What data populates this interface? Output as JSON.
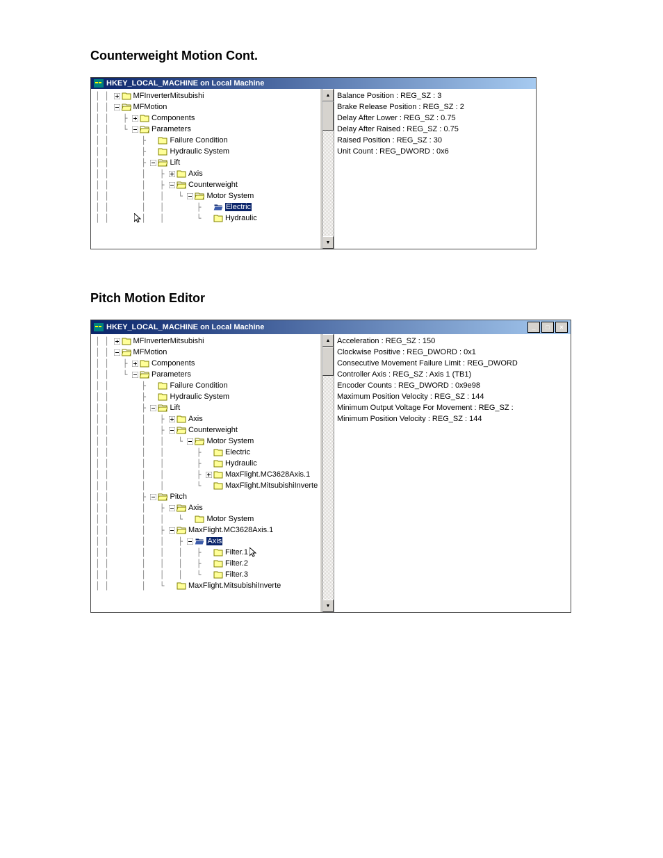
{
  "section1": {
    "heading": "Counterweight Motion Cont.",
    "window_title": "HKEY_LOCAL_MACHINE on Local Machine",
    "tree": [
      {
        "indent": "│ │ ",
        "box": "plus",
        "icon": "closed",
        "label": "MFInverterMitsubishi"
      },
      {
        "indent": "│ │ ",
        "box": "minus",
        "icon": "open",
        "label": "MFMotion"
      },
      {
        "indent": "│ │   ├ ",
        "box": "plus",
        "icon": "closed",
        "label": "Components"
      },
      {
        "indent": "│ │   └ ",
        "box": "minus",
        "icon": "open",
        "label": "Parameters"
      },
      {
        "indent": "│ │       ├ ",
        "box": "",
        "icon": "closed",
        "label": "Failure Condition"
      },
      {
        "indent": "│ │       ├ ",
        "box": "",
        "icon": "closed",
        "label": "Hydraulic System"
      },
      {
        "indent": "│ │       ├ ",
        "box": "minus",
        "icon": "open",
        "label": "Lift"
      },
      {
        "indent": "│ │       │   ├ ",
        "box": "plus",
        "icon": "closed",
        "label": "Axis"
      },
      {
        "indent": "│ │       │   ├ ",
        "box": "minus",
        "icon": "open",
        "label": "Counterweight"
      },
      {
        "indent": "│ │       │   │   └ ",
        "box": "minus",
        "icon": "open",
        "label": "Motor System"
      },
      {
        "indent": "│ │       │   │       ├ ",
        "box": "",
        "icon": "sel",
        "label": "Electric",
        "selected": true
      },
      {
        "indent": "│ │       │   │       └ ",
        "box": "",
        "icon": "closed",
        "label": "Hydraulic"
      }
    ],
    "cursor_on_row": 11,
    "values": [
      "Balance Position : REG_SZ : 3",
      "Brake Release Position : REG_SZ : 2",
      "Delay After Lower : REG_SZ : 0.75",
      "Delay After Raised : REG_SZ : 0.75",
      "Raised Position : REG_SZ : 30",
      "Unit Count : REG_DWORD : 0x6"
    ]
  },
  "section2": {
    "heading": "Pitch Motion Editor",
    "window_title": "HKEY_LOCAL_MACHINE on Local Machine",
    "tree": [
      {
        "indent": "│ │ ",
        "box": "plus",
        "icon": "closed",
        "label": "MFInverterMitsubishi"
      },
      {
        "indent": "│ │ ",
        "box": "minus",
        "icon": "open",
        "label": "MFMotion"
      },
      {
        "indent": "│ │   ├ ",
        "box": "plus",
        "icon": "closed",
        "label": "Components"
      },
      {
        "indent": "│ │   └ ",
        "box": "minus",
        "icon": "open",
        "label": "Parameters"
      },
      {
        "indent": "│ │       ├ ",
        "box": "",
        "icon": "closed",
        "label": "Failure Condition"
      },
      {
        "indent": "│ │       ├ ",
        "box": "",
        "icon": "closed",
        "label": "Hydraulic System"
      },
      {
        "indent": "│ │       ├ ",
        "box": "minus",
        "icon": "open",
        "label": "Lift"
      },
      {
        "indent": "│ │       │   ├ ",
        "box": "plus",
        "icon": "closed",
        "label": "Axis"
      },
      {
        "indent": "│ │       │   ├ ",
        "box": "minus",
        "icon": "open",
        "label": "Counterweight"
      },
      {
        "indent": "│ │       │   │   └ ",
        "box": "minus",
        "icon": "open",
        "label": "Motor System"
      },
      {
        "indent": "│ │       │   │       ├ ",
        "box": "",
        "icon": "closed",
        "label": "Electric"
      },
      {
        "indent": "│ │       │   │       ├ ",
        "box": "",
        "icon": "closed",
        "label": "Hydraulic"
      },
      {
        "indent": "│ │       │   │       ├ ",
        "box": "plus",
        "icon": "closed",
        "label": "MaxFlight.MC3628Axis.1"
      },
      {
        "indent": "│ │       │   │       └ ",
        "box": "",
        "icon": "closed",
        "label": "MaxFlight.MitsubishiInverte"
      },
      {
        "indent": "│ │       ├ ",
        "box": "minus",
        "icon": "open",
        "label": "Pitch"
      },
      {
        "indent": "│ │       │   ├ ",
        "box": "minus",
        "icon": "open",
        "label": "Axis"
      },
      {
        "indent": "│ │       │   │   └ ",
        "box": "",
        "icon": "closed",
        "label": "Motor System"
      },
      {
        "indent": "│ │       │   ├ ",
        "box": "minus",
        "icon": "open",
        "label": "MaxFlight.MC3628Axis.1"
      },
      {
        "indent": "│ │       │   │   ├ ",
        "box": "minus",
        "icon": "sel",
        "label": "Axis",
        "selected": true
      },
      {
        "indent": "│ │       │   │   │   ├ ",
        "box": "",
        "icon": "closed",
        "label": "Filter.1",
        "cursor": true
      },
      {
        "indent": "│ │       │   │   │   ├ ",
        "box": "",
        "icon": "closed",
        "label": "Filter.2"
      },
      {
        "indent": "│ │       │   │   │   └ ",
        "box": "",
        "icon": "closed",
        "label": "Filter.3"
      },
      {
        "indent": "│ │       │   └ ",
        "box": "",
        "icon": "closed",
        "label": "MaxFlight.MitsubishiInverte"
      }
    ],
    "values": [
      "Acceleration : REG_SZ : 150",
      "Clockwise Positive : REG_DWORD : 0x1",
      "Consecutive Movement Failure Limit : REG_DWORD",
      "Controller Axis : REG_SZ : Axis 1 (TB1)",
      "Encoder Counts : REG_DWORD : 0x9e98",
      "Maximum Position Velocity : REG_SZ : 144",
      "Minimum Output Voltage For Movement : REG_SZ :",
      "Minimum Position Velocity : REG_SZ : 144"
    ]
  },
  "icons": {
    "window_controls": {
      "min": "_",
      "max": "□",
      "close": "×"
    },
    "scroll": {
      "up": "▲",
      "down": "▼"
    }
  }
}
